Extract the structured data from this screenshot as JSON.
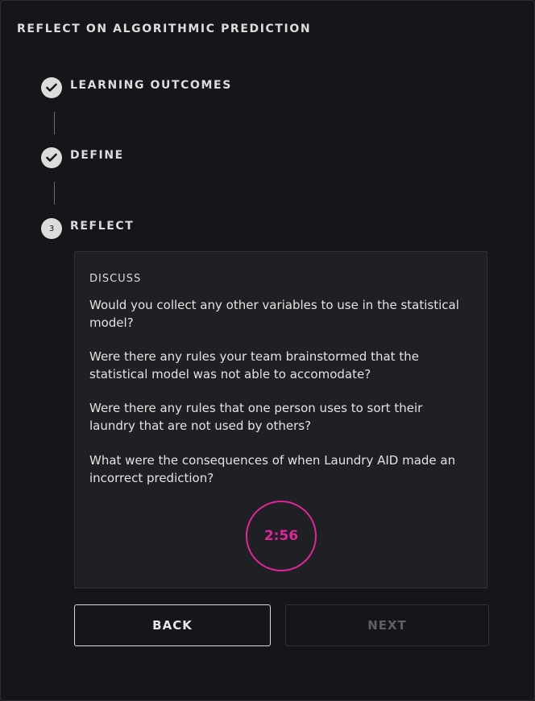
{
  "panel": {
    "title": "REFLECT ON ALGORITHMIC PREDICTION"
  },
  "steps": [
    {
      "label": "LEARNING OUTCOMES",
      "status": "completed",
      "icon": "check-icon"
    },
    {
      "label": "DEFINE",
      "status": "completed",
      "icon": "check-icon"
    },
    {
      "label": "REFLECT",
      "status": "current",
      "number": "3"
    }
  ],
  "discussion": {
    "heading": "DISCUSS",
    "questions": [
      "Would you collect any other variables to use in the statistical model?",
      "Were there any rules your team brainstormed that the statistical model was not able to accomodate?",
      "Were there any rules that one person uses to sort their laundry that are not used by others?",
      "What were the consequences of when Laundry AID made an incorrect prediction?"
    ],
    "timer": "2:56"
  },
  "buttons": {
    "back": "BACK",
    "next": "NEXT"
  },
  "colors": {
    "background": "#151619",
    "card": "#1e2024",
    "accent": "#e0269a",
    "step_circle": "#dcdcdc"
  }
}
